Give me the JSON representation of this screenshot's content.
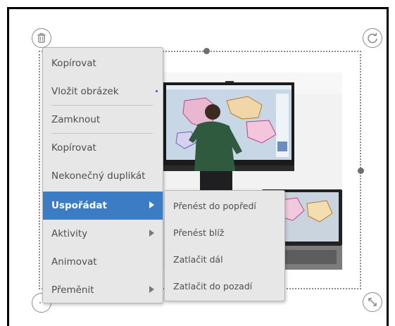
{
  "context_menu": {
    "items": [
      {
        "label": "Kopírovat",
        "has_submenu": false
      },
      {
        "label": "Vložit obrázek",
        "has_submenu": false
      },
      {
        "label": "Zamknout",
        "has_submenu": false
      },
      {
        "label": "Kopírovat",
        "has_submenu": false
      },
      {
        "label": "Nekonečný duplikát",
        "has_submenu": false
      },
      {
        "label": "Uspořádat",
        "has_submenu": true,
        "active": true
      },
      {
        "label": "Aktivity",
        "has_submenu": true
      },
      {
        "label": "Animovat",
        "has_submenu": false
      },
      {
        "label": "Přeměnit",
        "has_submenu": true
      }
    ]
  },
  "submenu": {
    "items": [
      {
        "label": "Přenést do popředí"
      },
      {
        "label": "Přenést blíž"
      },
      {
        "label": "Zatlačit dál"
      },
      {
        "label": "Zatlačit do pozadí"
      }
    ]
  },
  "colors": {
    "active_item": "#3b7cc4",
    "menu_background": "#e7e7e7",
    "menu_text": "#4e4e4e"
  },
  "icons": {
    "top_left": "trash-icon",
    "top_right": "rotate-icon",
    "bottom_right": "resize-icon",
    "bottom_left": "clone-icon"
  }
}
